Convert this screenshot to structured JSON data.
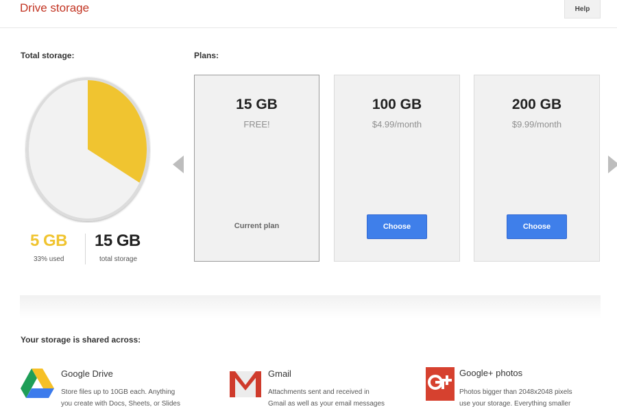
{
  "header": {
    "title": "Drive storage",
    "help_label": "Help"
  },
  "storage": {
    "label": "Total storage:",
    "used_fraction": 0.33,
    "used_value": "5 GB",
    "used_caption": "33% used",
    "total_value": "15 GB",
    "total_caption": "total storage",
    "used_color": "#f0c430"
  },
  "plans": {
    "label": "Plans:",
    "items": [
      {
        "size": "15 GB",
        "price": "FREE!",
        "status": "Current plan"
      },
      {
        "size": "100 GB",
        "price": "$4.99/month",
        "action": "Choose"
      },
      {
        "size": "200 GB",
        "price": "$9.99/month",
        "action": "Choose"
      }
    ],
    "prev_icon": "arrow-left-icon",
    "next_icon": "arrow-right-icon"
  },
  "shared": {
    "label": "Your storage is shared across:",
    "services": [
      {
        "name": "Google Drive",
        "icon": "google-drive-icon",
        "desc_lines": [
          "Store files up to 10GB each. Anything",
          "you create with Docs, Sheets, or Slides"
        ]
      },
      {
        "name": "Gmail",
        "icon": "gmail-icon",
        "desc_lines": [
          "Attachments sent and received in",
          "Gmail as well as your email messages"
        ]
      },
      {
        "name": "Google+ photos",
        "icon": "google-plus-icon",
        "desc_lines": [
          "Photos bigger than 2048x2048 pixels",
          "use your storage. Everything smaller"
        ]
      }
    ]
  },
  "colors": {
    "accent": "#c23321",
    "button_blue": "#3f7fea",
    "card_bg": "#f1f1f1"
  }
}
